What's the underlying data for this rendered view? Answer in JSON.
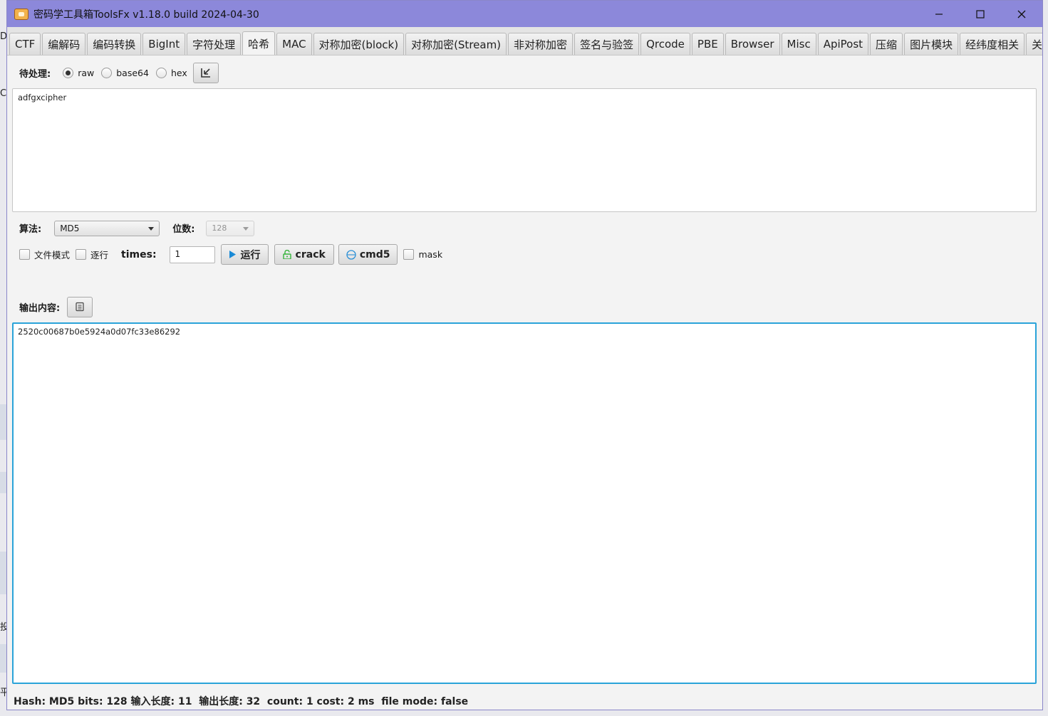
{
  "window": {
    "title": "密码学工具箱ToolsFx v1.18.0 build 2024-04-30",
    "minimize_glyph": "—",
    "maximize_glyph": "☐",
    "close_glyph": "✕"
  },
  "background_fragments": [
    "D",
    "C",
    "投",
    "平"
  ],
  "tabs": [
    {
      "label": "CTF"
    },
    {
      "label": "编解码"
    },
    {
      "label": "编码转换"
    },
    {
      "label": "BigInt"
    },
    {
      "label": "字符处理"
    },
    {
      "label": "哈希",
      "active": true
    },
    {
      "label": "MAC"
    },
    {
      "label": "对称加密(block)"
    },
    {
      "label": "对称加密(Stream)"
    },
    {
      "label": "非对称加密"
    },
    {
      "label": "签名与验签"
    },
    {
      "label": "Qrcode"
    },
    {
      "label": "PBE"
    },
    {
      "label": "Browser"
    },
    {
      "label": "Misc"
    },
    {
      "label": "ApiPost"
    },
    {
      "label": "压缩"
    },
    {
      "label": "图片模块"
    },
    {
      "label": "经纬度相关"
    },
    {
      "label": "关于"
    }
  ],
  "input_section": {
    "label": "待处理:",
    "encodings": [
      {
        "label": "raw",
        "selected": true
      },
      {
        "label": "base64",
        "selected": false
      },
      {
        "label": "hex",
        "selected": false
      }
    ],
    "import_icon": "import-icon",
    "text": "adfgxcipher"
  },
  "algorithm": {
    "label": "算法:",
    "selected": "MD5",
    "bits_label": "位数:",
    "bits_selected": "128"
  },
  "options": {
    "file_mode_label": "文件模式",
    "line_by_line_label": "逐行",
    "times_label": "times:",
    "times_value": "1",
    "run_label": "运行",
    "crack_label": "crack",
    "cmd5_label": "cmd5",
    "mask_label": "mask"
  },
  "output_section": {
    "label": "输出内容:",
    "copy_icon": "copy-icon",
    "text": "2520c00687b0e5924a0d07fc33e86292"
  },
  "status": {
    "text": "Hash: MD5 bits: 128 输入长度: 11  输出长度: 32  count: 1 cost: 2 ms  file mode: false"
  },
  "colors": {
    "titlebar": "#8c88da",
    "focus_border": "#2aa3d9",
    "run_icon": "#1a8ad6",
    "crack_icon": "#35b43a"
  }
}
